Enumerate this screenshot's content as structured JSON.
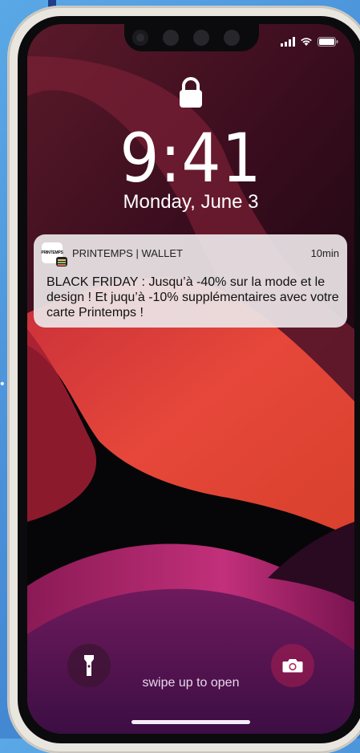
{
  "status": {
    "icons": [
      "signal-bars-icon",
      "wifi-icon",
      "battery-icon"
    ]
  },
  "lock_icon": "lock-icon",
  "time": "9:41",
  "date": "Monday, June 3",
  "notification": {
    "app_icon_text": "PRINTEMPS",
    "app_name": "PRINTEMPS | WALLET",
    "time_ago": "10min",
    "body": "BLACK FRIDAY : Jusqu’à -40% sur la mode et le design ! Et juqu’à -10% supplémentaires avec votre carte Printemps !"
  },
  "bottom": {
    "flashlight_icon": "flashlight-icon",
    "camera_icon": "camera-icon",
    "swipe_text": "swipe up to open"
  },
  "colors": {
    "wallpaper_red": "#e0413a",
    "wallpaper_magenta": "#a4206a",
    "notification_bg": "#ece6e8"
  }
}
